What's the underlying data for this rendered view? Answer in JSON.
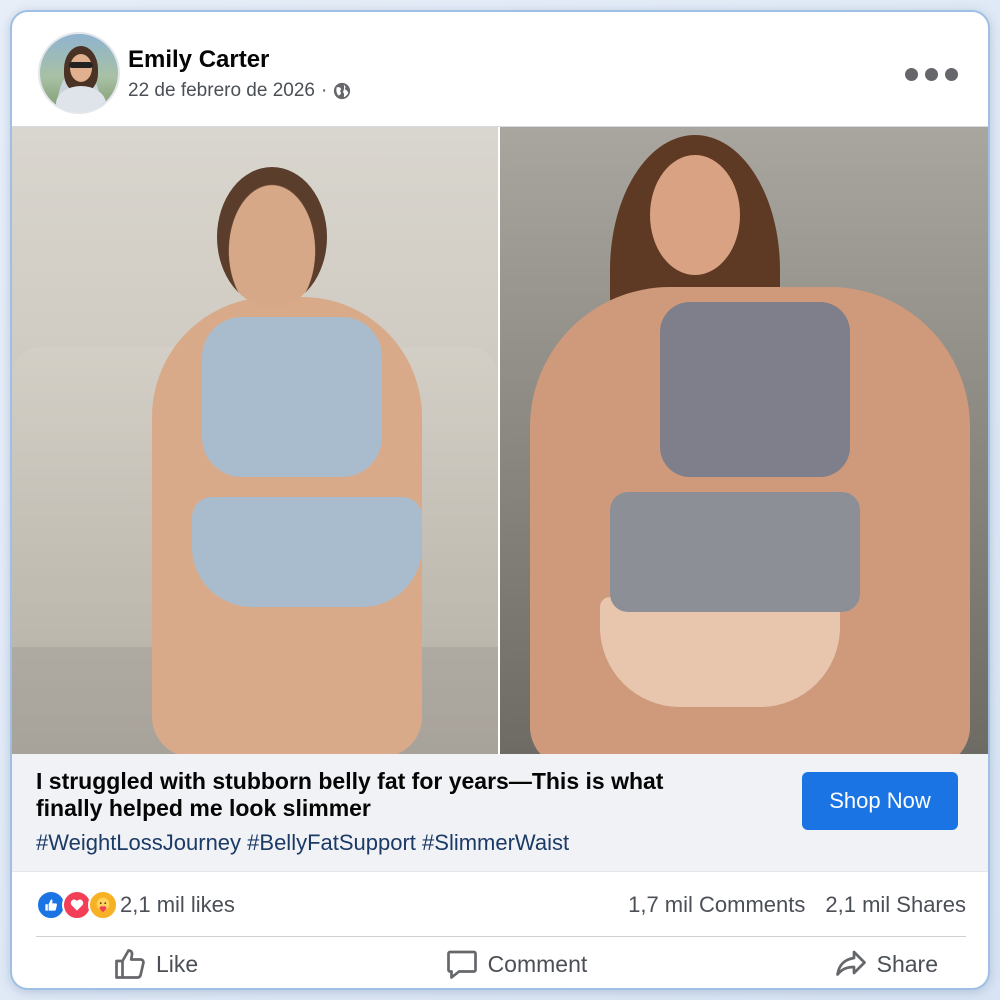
{
  "post": {
    "author": "Emily Carter",
    "date": "22 de febrero de 2026",
    "separator": "·",
    "audience_icon": "globe-icon",
    "more_icon": "more-options-icon"
  },
  "images": {
    "left_alt": "before-photo",
    "right_alt": "after-photo"
  },
  "ad": {
    "headline": "I struggled with stubborn belly fat for years—This is what finally helped me look slimmer",
    "hashtags": "#WeightLossJourney #BellyFatSupport #SlimmerWaist",
    "cta_label": "Shop Now"
  },
  "stats": {
    "likes": "2,1 mil likes",
    "comments": "1,7 mil Comments",
    "shares": "2,1 mil Shares",
    "reaction_icons": [
      "like-icon",
      "love-icon",
      "care-icon"
    ]
  },
  "actions": {
    "like_label": "Like",
    "comment_label": "Comment",
    "share_label": "Share"
  },
  "colors": {
    "accent": "#1b74e4",
    "love": "#f33e58",
    "care": "#f7b125",
    "hashtag": "#1c3a66",
    "card_border": "#9fc0e4"
  }
}
